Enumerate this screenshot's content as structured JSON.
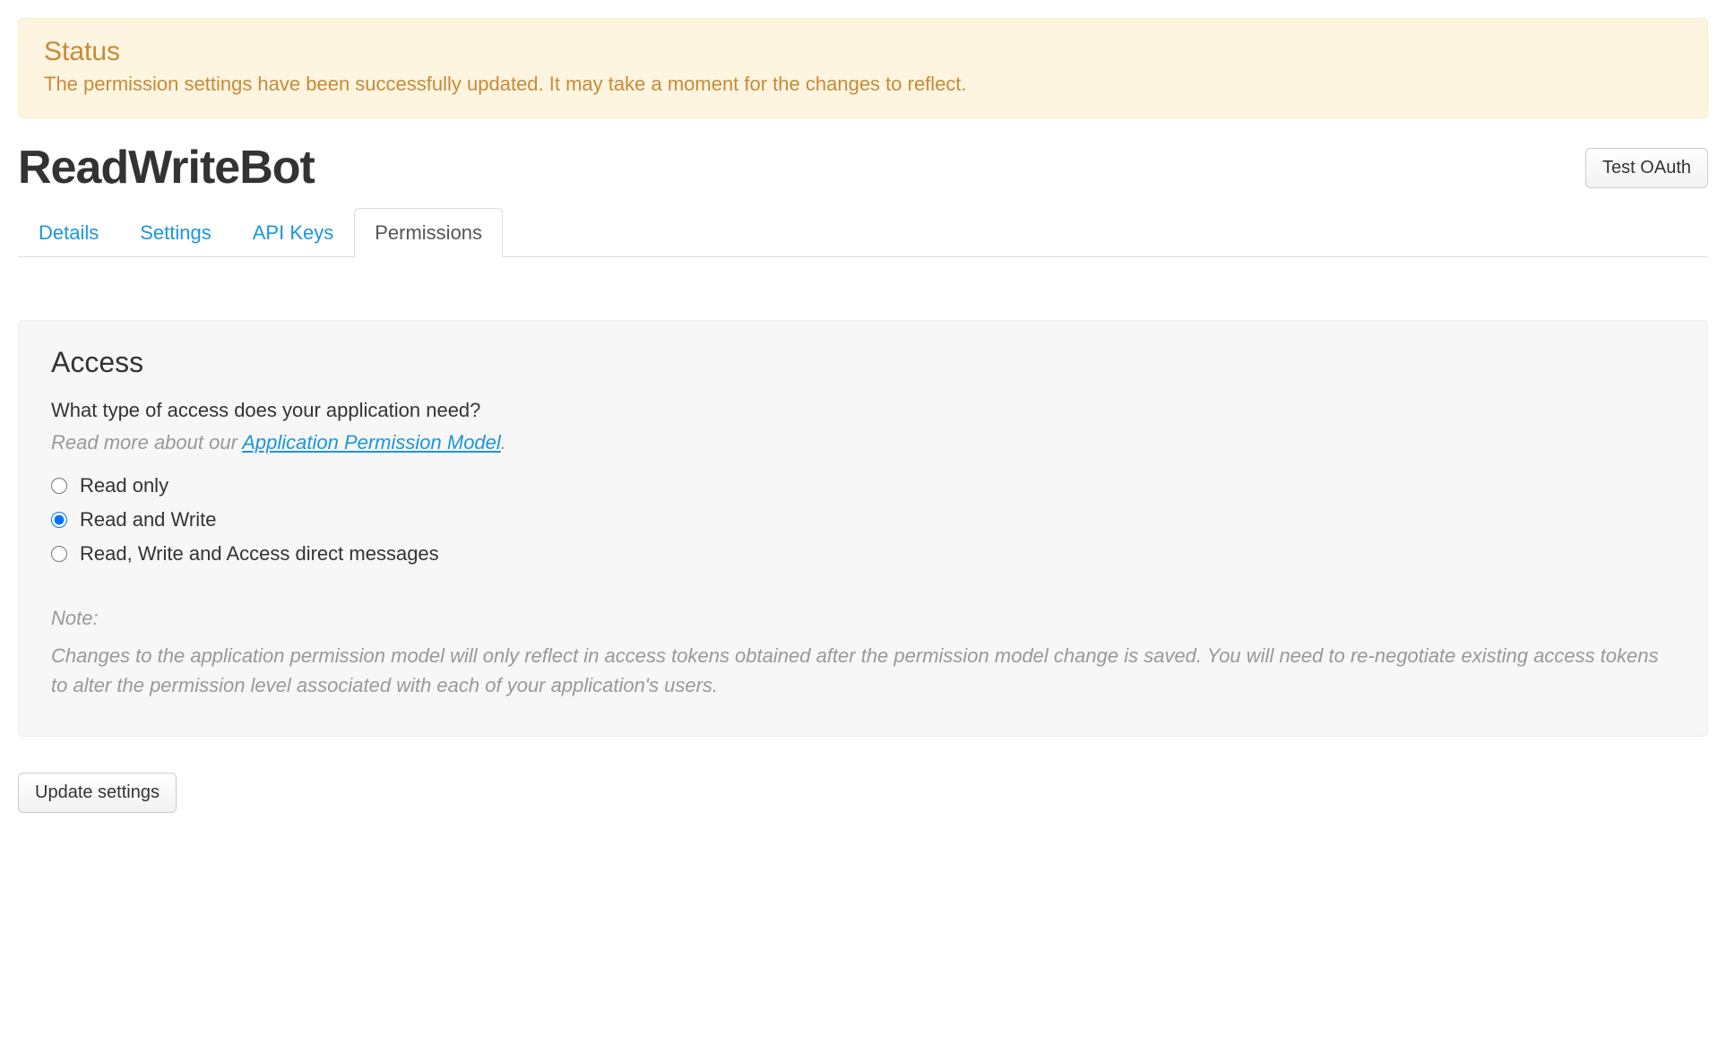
{
  "status": {
    "title": "Status",
    "message": "The permission settings have been successfully updated. It may take a moment for the changes to reflect."
  },
  "header": {
    "app_name": "ReadWriteBot",
    "test_oauth_label": "Test OAuth"
  },
  "tabs": {
    "details": "Details",
    "settings": "Settings",
    "api_keys": "API Keys",
    "permissions": "Permissions"
  },
  "access": {
    "heading": "Access",
    "question": "What type of access does your application need?",
    "hint_prefix": "Read more about our ",
    "hint_link": "Application Permission Model",
    "hint_suffix": ".",
    "options": {
      "read_only": "Read only",
      "read_write": "Read and Write",
      "read_write_dm": "Read, Write and Access direct messages"
    },
    "selected": "read_write",
    "note_label": "Note:",
    "note_text": "Changes to the application permission model will only reflect in access tokens obtained after the permission model change is saved. You will need to re-negotiate existing access tokens to alter the permission level associated with each of your application's users."
  },
  "actions": {
    "update_label": "Update settings"
  }
}
